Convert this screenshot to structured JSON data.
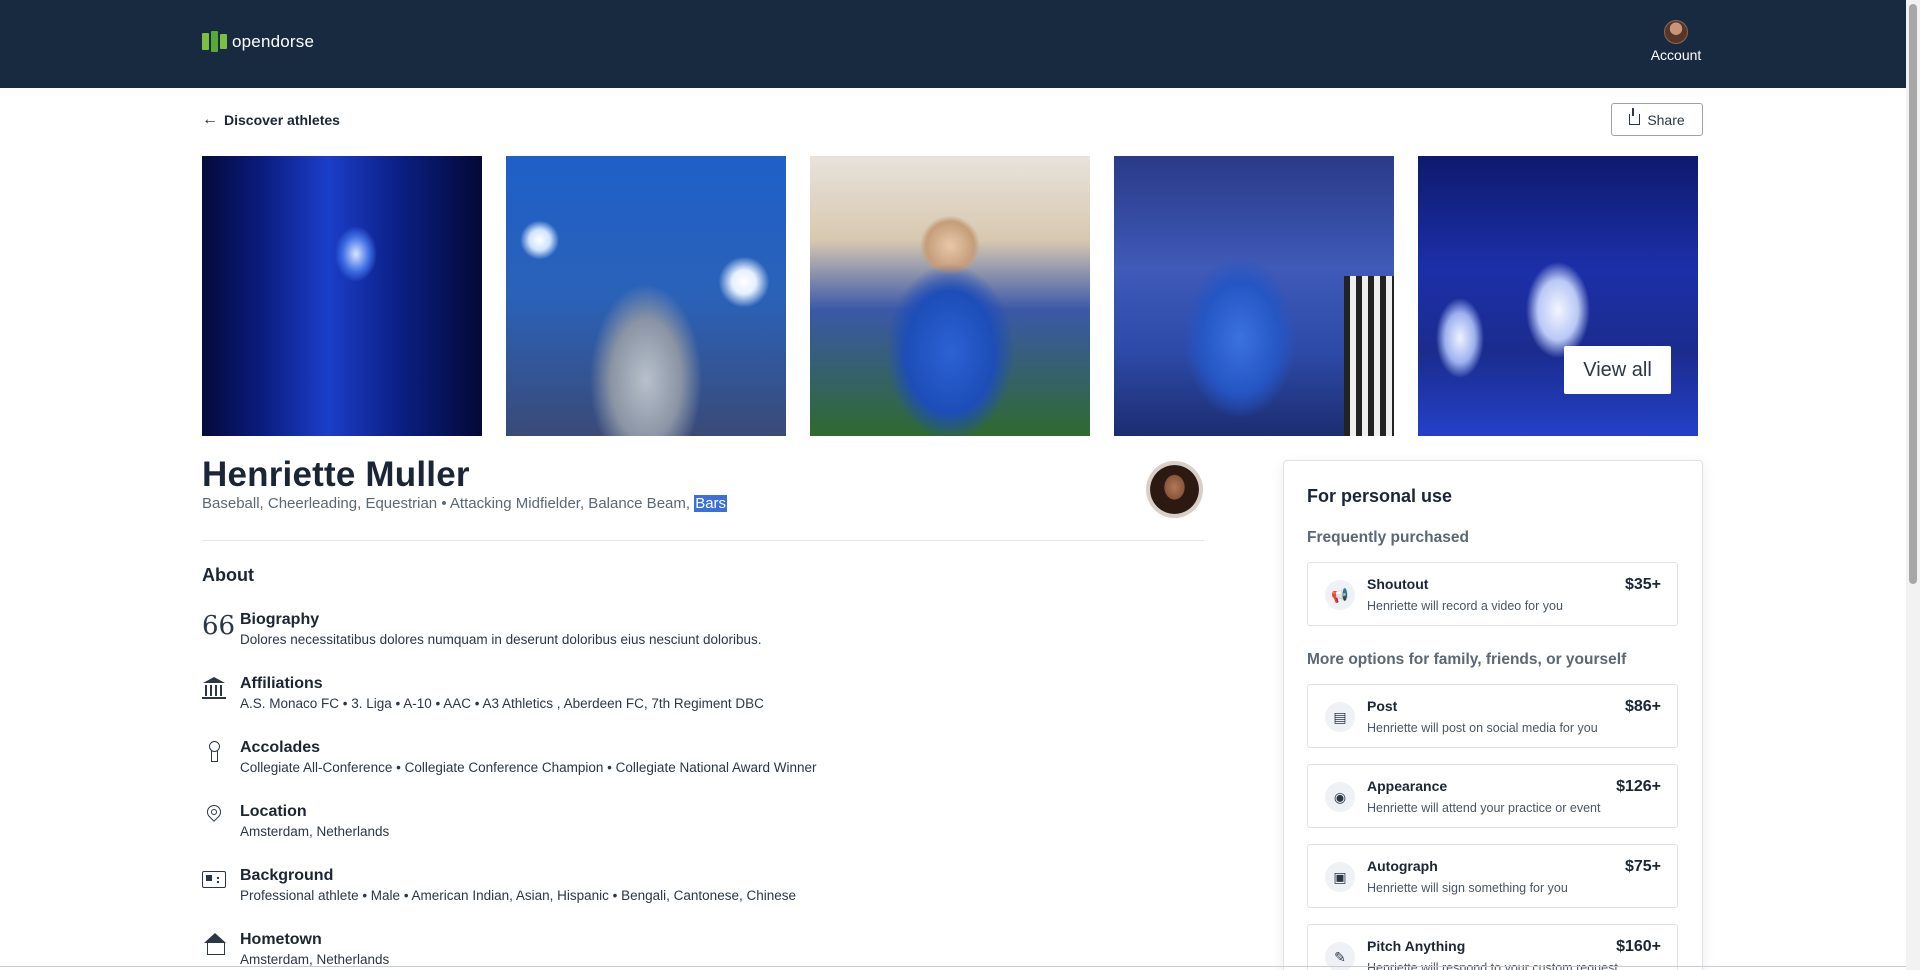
{
  "header": {
    "logo_text": "opendorse",
    "account_label": "Account"
  },
  "nav": {
    "back_label": "Discover athletes",
    "share_label": "Share"
  },
  "gallery": {
    "view_all_label": "View all"
  },
  "athlete": {
    "name": "Henriette Muller",
    "sports_text": "Baseball, Cheerleading, Equestrian • Attacking Midfielder, Balance Beam, ",
    "sports_selected": "Bars"
  },
  "about": {
    "title": "About",
    "items": [
      {
        "label": "Biography",
        "value": "Dolores necessitatibus dolores numquam in deserunt doloribus eius nesciunt doloribus.",
        "icon": "quote-icon"
      },
      {
        "label": "Affiliations",
        "value": "A.S. Monaco FC • 3. Liga • A-10 • AAC • A3 Athletics , Aberdeen FC, 7th Regiment DBC",
        "icon": "institution-icon"
      },
      {
        "label": "Accolades",
        "value": "Collegiate All-Conference • Collegiate Conference Champion • Collegiate National Award Winner",
        "icon": "medal-icon"
      },
      {
        "label": "Location",
        "value": "Amsterdam, Netherlands",
        "icon": "location-pin-icon"
      },
      {
        "label": "Background",
        "value": "Professional athlete • Male • American Indian, Asian, Hispanic • Bengali, Cantonese, Chinese",
        "icon": "id-card-icon"
      },
      {
        "label": "Hometown",
        "value": "Amsterdam, Netherlands",
        "icon": "home-icon"
      }
    ]
  },
  "panel": {
    "title": "For personal use",
    "frequently_label": "Frequently purchased",
    "more_label": "More options for family, friends, or yourself",
    "offers": [
      {
        "name": "Shoutout",
        "desc": "Henriette will record a video for you",
        "price": "$35+",
        "icon": "megaphone-icon"
      },
      {
        "name": "Post",
        "desc": "Henriette will post on social media for you",
        "price": "$86+",
        "icon": "post-icon"
      },
      {
        "name": "Appearance",
        "desc": "Henriette will attend your practice or event",
        "price": "$126+",
        "icon": "eye-icon"
      },
      {
        "name": "Autograph",
        "desc": "Henriette will sign something for you",
        "price": "$75+",
        "icon": "autograph-icon"
      },
      {
        "name": "Pitch Anything",
        "desc": "Henriette will respond to your custom request",
        "price": "$160+",
        "icon": "pencil-icon"
      }
    ]
  },
  "colors": {
    "header_bg": "#172a40",
    "logo_green": "#7bc043",
    "selection": "#3d6fd8"
  }
}
